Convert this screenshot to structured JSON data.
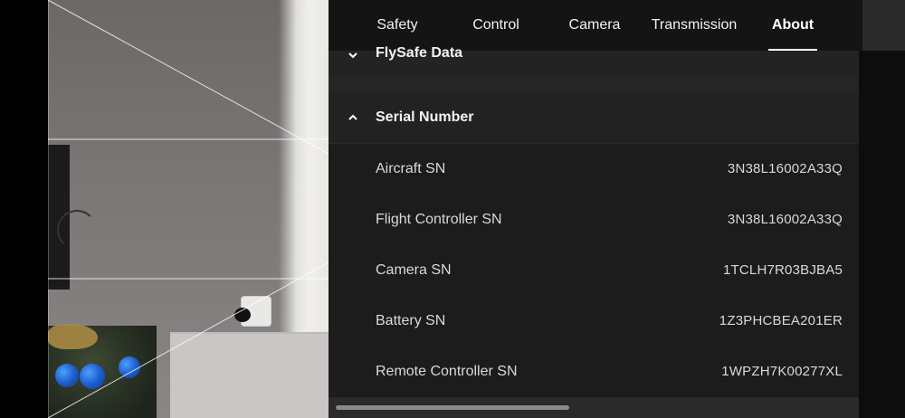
{
  "tabs": [
    {
      "label": "Safety",
      "active": false
    },
    {
      "label": "Control",
      "active": false
    },
    {
      "label": "Camera",
      "active": false
    },
    {
      "label": "Transmission",
      "active": false
    },
    {
      "label": "About",
      "active": true
    }
  ],
  "sections": {
    "flysafe": {
      "title": "FlySafe Data",
      "expanded": false,
      "icon": "chevron-down-icon"
    },
    "serial": {
      "title": "Serial Number",
      "expanded": true,
      "icon": "chevron-up-icon"
    }
  },
  "serial_rows": [
    {
      "label": "Aircraft SN",
      "value": "3N38L16002A33Q"
    },
    {
      "label": "Flight Controller SN",
      "value": "3N38L16002A33Q"
    },
    {
      "label": "Camera SN",
      "value": "1TCLH7R03BJBA5"
    },
    {
      "label": "Battery SN",
      "value": "1Z3PHCBEA201ER"
    },
    {
      "label": "Remote Controller SN",
      "value": "1WPZH7K00277XL"
    }
  ],
  "colors": {
    "panel_bg": "#1c1c1c",
    "tab_bar_bg": "#141414",
    "text": "#d9d9d9",
    "accent_underline": "#ffffff"
  }
}
